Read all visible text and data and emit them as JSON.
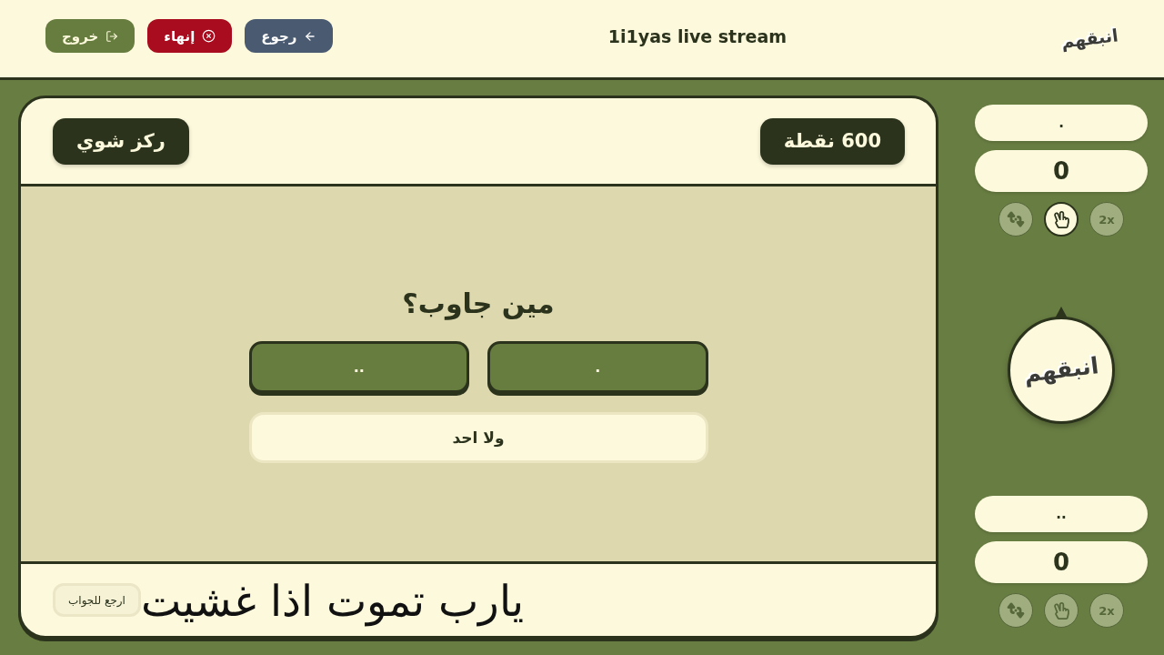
{
  "header": {
    "logo": "انبقهم",
    "title": "1i1yas live stream",
    "buttons": [
      {
        "kind": "back",
        "label": "رجوع"
      },
      {
        "kind": "end",
        "label": "إنهاء"
      },
      {
        "kind": "exit",
        "label": "خروج"
      }
    ]
  },
  "question_card": {
    "points": "600 نقطة",
    "tag": "ركز شوي",
    "question": "مين جاوب؟",
    "answers": [
      {
        "kind": "team",
        "label": "."
      },
      {
        "kind": "team",
        "label": ".."
      },
      {
        "kind": "none",
        "label": "ولا احد"
      }
    ],
    "footer": {
      "message": "يارب تموت اذا غشيت",
      "button": "ارجع للجواب"
    }
  },
  "teams": [
    {
      "name": ".",
      "score": "0",
      "turn": true,
      "lifelines": [
        {
          "kind": "double",
          "label": "2x",
          "active": false
        },
        {
          "kind": "hand",
          "active": true
        },
        {
          "kind": "swap",
          "active": false
        }
      ]
    },
    {
      "name": "..",
      "score": "0",
      "turn": false,
      "lifelines": [
        {
          "kind": "double",
          "label": "2x",
          "active": false
        },
        {
          "kind": "hand",
          "active": false
        },
        {
          "kind": "swap",
          "active": false
        }
      ]
    }
  ],
  "turn_badge": {
    "logo": "انبقهم"
  }
}
